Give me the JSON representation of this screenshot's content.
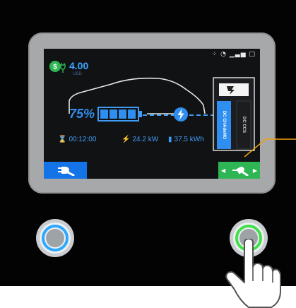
{
  "screen": {
    "status_icons": "⁘ ◔ ▁▃▅ □",
    "cost": {
      "value": "4.00",
      "unit": "USD",
      "icon": "dollar-plug-icon"
    },
    "battery": {
      "percent": "75%",
      "level": 0.75,
      "icon": "battery-icon"
    },
    "connectors": [
      {
        "label": "DC CHAdeMO",
        "selected": true
      },
      {
        "label": "DC CCS",
        "selected": false
      }
    ],
    "connector_header_icon": "dc-charger-icon",
    "stats": {
      "time": "00:12:00",
      "power": "24.2 kW",
      "energy": "37.5 kWh"
    },
    "left_button_icon": "unplug-icon",
    "right_button_icon": "plug-select-icon"
  },
  "hardware": {
    "left_button": {
      "ring_color": "#2ea8ff"
    },
    "right_button": {
      "ring_color": "#3fe04a"
    }
  },
  "colors": {
    "accent_blue": "#2f8ff0",
    "accent_green": "#2eb655",
    "callout": "#f2a10c"
  }
}
